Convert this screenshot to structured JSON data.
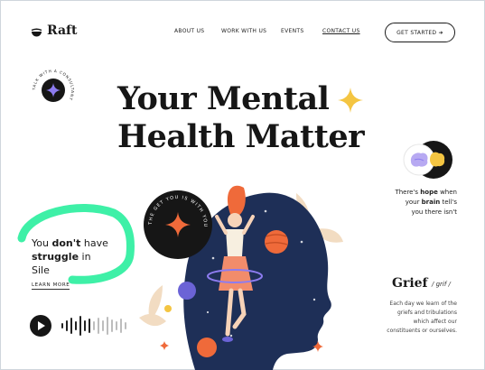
{
  "brand": {
    "name": "Raft"
  },
  "nav": {
    "items": [
      {
        "label": "ABOUT US"
      },
      {
        "label": "WORK WITH US"
      },
      {
        "label": "EVENTS"
      },
      {
        "label": "CONTACT US"
      }
    ],
    "cta_label": "GET STARTED ➜"
  },
  "hero": {
    "title_line1": "Your Mental",
    "title_line2": "Health Matter",
    "lead_pre": "You ",
    "lead_bold1": "don't",
    "lead_mid": " have",
    "lead_line2_pre": "",
    "lead_bold2": "struggle",
    "lead_line2_post": " in",
    "lead_line3": "Sile",
    "learn_more": "LEARN MORE"
  },
  "badges": {
    "left_circular_text": "TALK WITH A CONSULTANT",
    "center_circular_text": "THE GET YOU IS WITH YOU"
  },
  "hope": {
    "pre": "There's ",
    "bold1": "hope",
    "mid1": " when",
    "line2_pre": "your ",
    "bold2": "brain",
    "line2_post": " tell's",
    "line3": "you there isn't"
  },
  "grief": {
    "word": "Grief",
    "phonetic": "/ grif /",
    "line1": "Each day we learn of the",
    "line2": "griefs and tribulations",
    "line3": "which affect our",
    "line4": "constituents or ourselves."
  },
  "colors": {
    "dark": "#161616",
    "accent_yellow": "#f4c542",
    "highlight_green": "#3ef0a7",
    "navy": "#1e2f57",
    "orange": "#ef6a3a",
    "purple": "#8d7cf0"
  }
}
